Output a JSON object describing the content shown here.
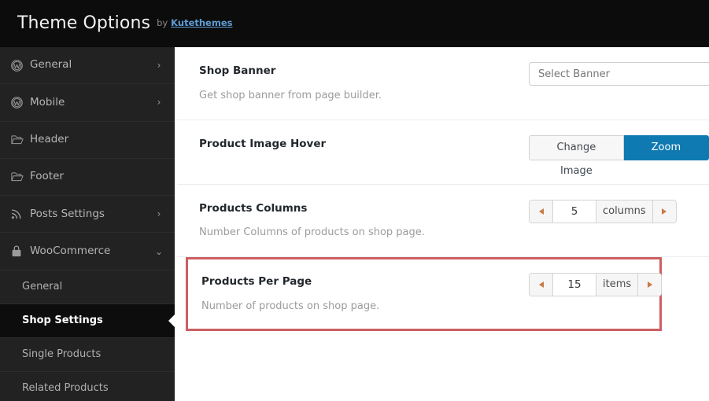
{
  "topbar": {
    "title": "Theme Options",
    "by": "by",
    "brand": "Kutethemes"
  },
  "sidebar": {
    "items": [
      {
        "label": "General",
        "icon": "wordpress-icon",
        "chevron": "›"
      },
      {
        "label": "Mobile",
        "icon": "wordpress-icon",
        "chevron": "›"
      },
      {
        "label": "Header",
        "icon": "folder-icon",
        "chevron": ""
      },
      {
        "label": "Footer",
        "icon": "folder-icon",
        "chevron": ""
      },
      {
        "label": "Posts Settings",
        "icon": "rss-icon",
        "chevron": "›"
      },
      {
        "label": "WooCommerce",
        "icon": "shopping-bag-icon",
        "chevron": "⌄"
      }
    ],
    "sub_items": [
      {
        "label": "General",
        "active": false
      },
      {
        "label": "Shop Settings",
        "active": true
      },
      {
        "label": "Single Products",
        "active": false
      },
      {
        "label": "Related Products",
        "active": false
      }
    ]
  },
  "main": {
    "rows": [
      {
        "title": "Shop Banner",
        "desc": "Get shop banner from page builder.",
        "control": "select",
        "placeholder": "Select Banner",
        "value": ""
      },
      {
        "title": "Product Image Hover",
        "desc": "",
        "control": "buttons",
        "buttons": [
          {
            "label": "Change Image",
            "active": false
          },
          {
            "label": "Zoom Image",
            "active": true
          }
        ]
      },
      {
        "title": "Products Columns",
        "desc": "Number Columns of products on shop page.",
        "control": "stepper",
        "value": "5",
        "unit": "columns"
      },
      {
        "title": "Products Per Page",
        "desc": "Number of products on shop page.",
        "control": "stepper",
        "value": "15",
        "unit": "items",
        "highlighted": true
      }
    ]
  },
  "colors": {
    "accent_blue": "#0f7ab1",
    "highlight_red": "#cc5f61",
    "sidebar_bg": "#222222",
    "topbar_bg": "#0c0c0c",
    "link_blue": "#5e9ed6",
    "stepper_arrow": "#c77b43"
  }
}
